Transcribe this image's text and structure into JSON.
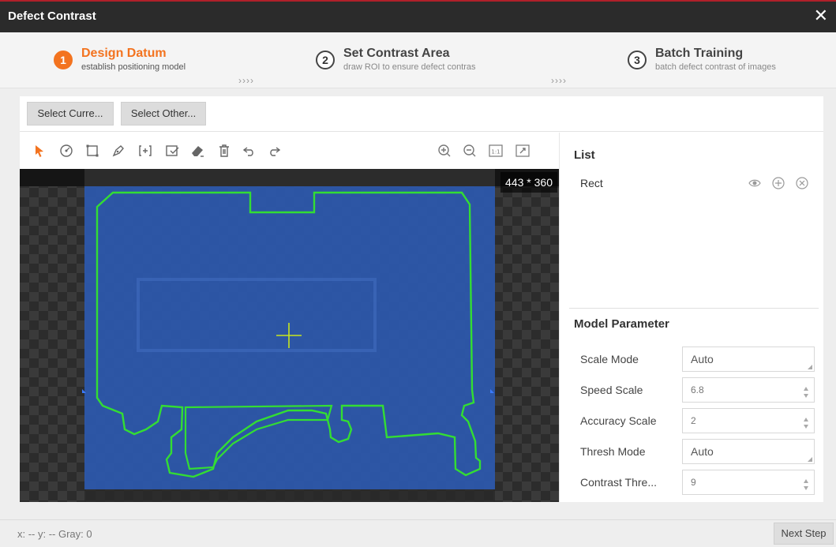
{
  "window": {
    "title": "Defect Contrast",
    "close_glyph": "✕"
  },
  "steps": [
    {
      "num": "1",
      "label": "Design Datum",
      "sub": "establish positioning model",
      "active": true
    },
    {
      "num": "2",
      "label": "Set Contrast Area",
      "sub": "draw ROI to ensure defect contras",
      "active": false
    },
    {
      "num": "3",
      "label": "Batch Training",
      "sub": "batch defect contrast of images",
      "active": false
    }
  ],
  "step_separator": "››››",
  "select_bar": {
    "current": "Select Curre...",
    "other": "Select Other..."
  },
  "toolbar": {
    "icons": [
      "pointer-icon",
      "circle-tool-icon",
      "rect-tool-icon",
      "pen-tool-icon",
      "expand-roi-icon",
      "mask-icon",
      "eraser-icon",
      "delete-icon",
      "undo-icon",
      "redo-icon",
      "zoom-in-icon",
      "zoom-out-icon",
      "actual-size-icon",
      "fit-screen-icon"
    ],
    "actual_size_label": "1:1"
  },
  "canvas": {
    "size_label": "443 * 360"
  },
  "list": {
    "heading": "List",
    "items": [
      {
        "name": "Rect"
      }
    ]
  },
  "model": {
    "heading": "Model Parameter",
    "params": [
      {
        "label": "Scale Mode",
        "value": "Auto",
        "kind": "select"
      },
      {
        "label": "Speed Scale",
        "value": "6.8",
        "kind": "number"
      },
      {
        "label": "Accuracy Scale",
        "value": "2",
        "kind": "number"
      },
      {
        "label": "Thresh Mode",
        "value": "Auto",
        "kind": "select"
      },
      {
        "label": "Contrast Thre...",
        "value": "9",
        "kind": "number"
      }
    ]
  },
  "status": {
    "coords": "x: --  y: --   Gray: 0",
    "next": "Next Step"
  },
  "colors": {
    "accent": "#f3731f",
    "roi": "#2d5fbf",
    "contour": "#33dd33",
    "titlebar": "#2b2b2b"
  }
}
